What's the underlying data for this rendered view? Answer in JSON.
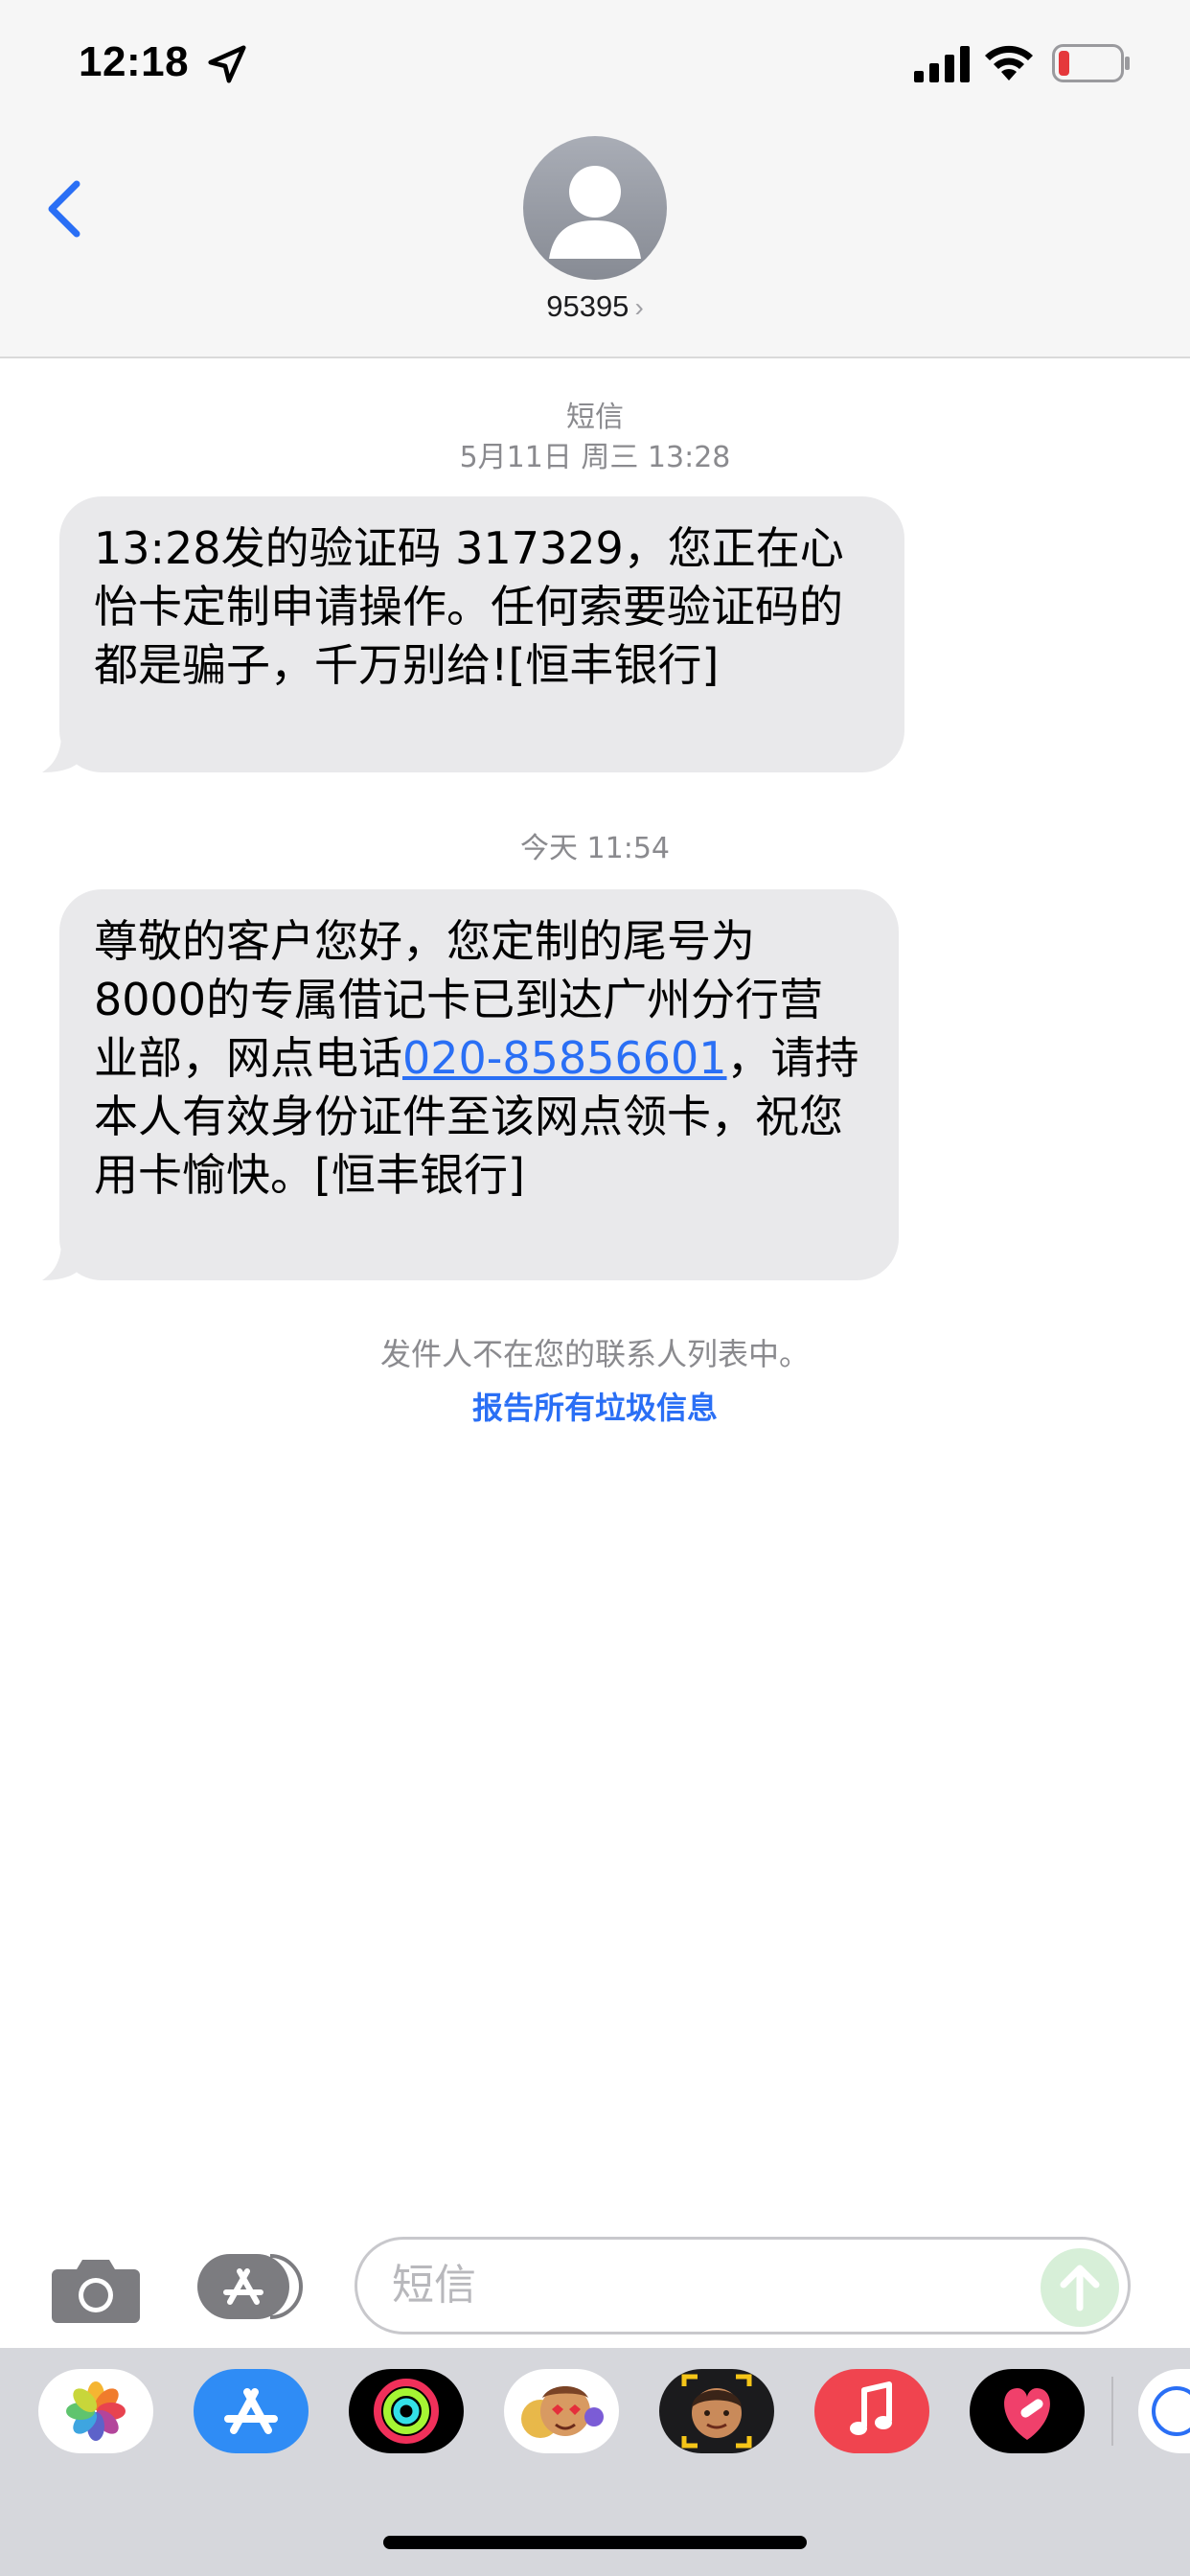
{
  "status_bar": {
    "time": "12:18",
    "icons": [
      "location-arrow-icon",
      "cellular-signal-icon",
      "wifi-icon",
      "battery-low-icon"
    ],
    "battery_color": "#e5383b"
  },
  "header": {
    "contact": "95395",
    "avatar_icon": "person-silhouette-icon",
    "back_icon": "chevron-left-icon",
    "accent": "#2a6ff5"
  },
  "conversation": {
    "first_group": {
      "service": "短信",
      "datetime": "5月11日 周三 13:28"
    },
    "message_1": "13:28发的验证码 317329，您正在心怡卡定制申请操作。任何索要验证码的都是骗子，千万别给![恒丰银行]",
    "second_group": {
      "datetime": "今天 11:54"
    },
    "message_2": {
      "text_before": "尊敬的客户您好，您定制的尾号为8000的专属借记卡已到达广州分行营业部，网点电话",
      "phone": "020-85856601",
      "text_after": "，请持本人有效身份证件至该网点领卡，祝您用卡愉快。[恒丰银行]"
    },
    "spam_note": "发件人不在您的联系人列表中。",
    "spam_link": "报告所有垃圾信息"
  },
  "composer": {
    "placeholder": "短信",
    "camera_icon": "camera-icon",
    "apps_icon": "app-store-icon",
    "send_icon": "arrow-up-icon"
  },
  "app_drawer": {
    "apps": [
      "photos-icon",
      "app-store-icon",
      "fitness-rings-icon",
      "memoji-stickers-icon",
      "memoji-icon",
      "music-icon",
      "heart-stickers-icon",
      "partial-app-icon"
    ]
  }
}
